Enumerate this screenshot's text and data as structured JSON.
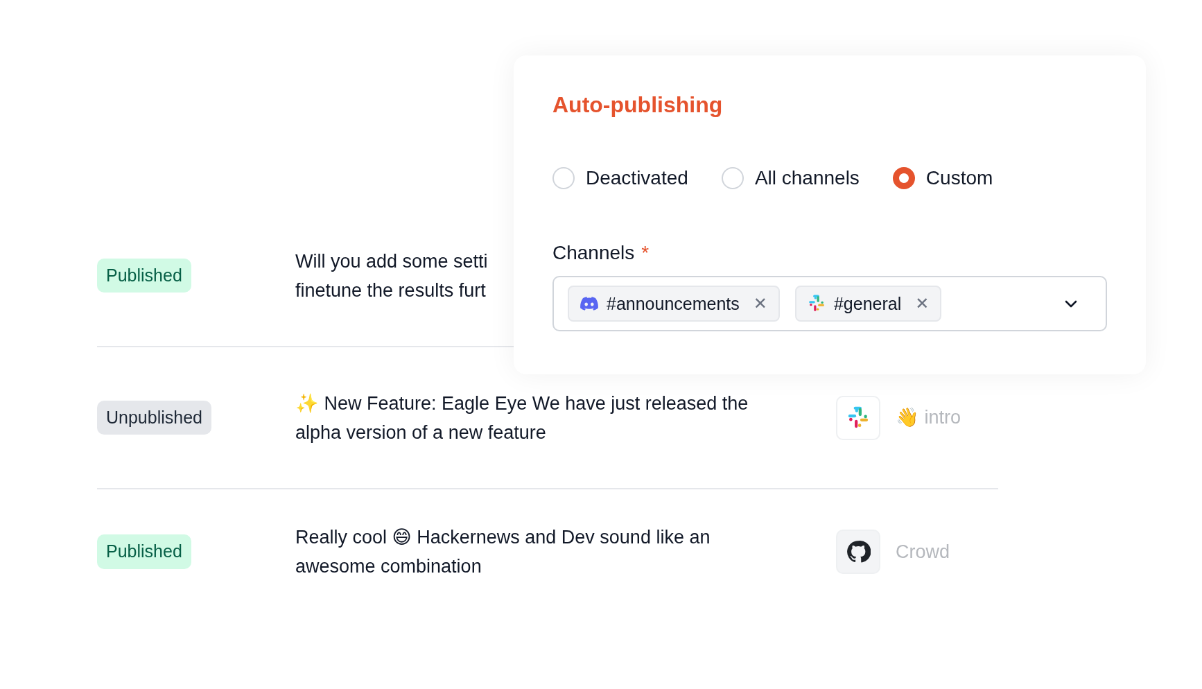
{
  "rows": [
    {
      "status": {
        "label": "Published",
        "kind": "published"
      },
      "message_lines": [
        "Will you add some setti",
        "finetune the results furt"
      ]
    },
    {
      "status": {
        "label": "Unpublished",
        "kind": "unpublished"
      },
      "message_lines": [
        "✨ New Feature: Eagle Eye We have just released the",
        "alpha version of a new feature"
      ],
      "source": {
        "kind": "slack",
        "text": "👋 intro"
      }
    },
    {
      "status": {
        "label": "Published",
        "kind": "published"
      },
      "message_lines": [
        "Really cool 😄 Hackernews and Dev sound like an",
        "awesome combination"
      ],
      "source": {
        "kind": "github",
        "text": "Crowd"
      }
    }
  ],
  "popup": {
    "title": "Auto-publishing",
    "options": [
      {
        "label": "Deactivated",
        "selected": false
      },
      {
        "label": "All channels",
        "selected": false
      },
      {
        "label": "Custom",
        "selected": true
      }
    ],
    "channels_label": "Channels",
    "required_mark": "*",
    "channels": [
      {
        "kind": "discord",
        "label": "#announcements",
        "remove": "✕"
      },
      {
        "kind": "slack",
        "label": "#general",
        "remove": "✕"
      }
    ]
  }
}
